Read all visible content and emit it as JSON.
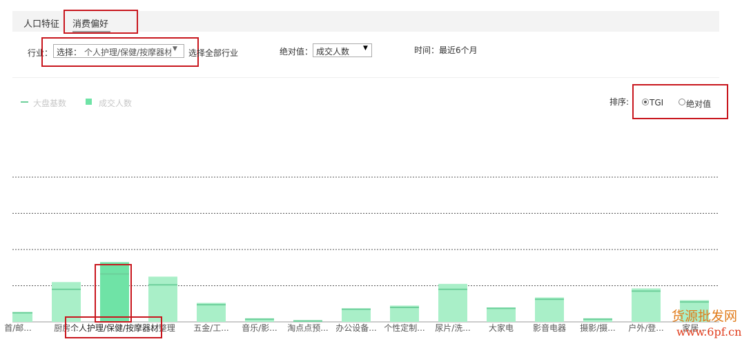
{
  "tabs": [
    {
      "label": "人口特征",
      "active": false
    },
    {
      "label": "消费偏好",
      "active": true
    }
  ],
  "filters": {
    "industry_label": "行业：",
    "industry_select_prefix": "选择：",
    "industry_select_value": "个人护理/保健/按摩器材",
    "select_all_link": "选择全部行业",
    "absolute_label": "绝对值：",
    "absolute_select_value": "成交人数",
    "time_text": "时间：最近6个月"
  },
  "legend": {
    "baseline_label": "大盘基数",
    "value_label": "成交人数"
  },
  "sort": {
    "label": "排序:",
    "options": [
      {
        "label": "TGI",
        "selected": true
      },
      {
        "label": "绝对值",
        "selected": false
      }
    ]
  },
  "watermark": {
    "line1": "货源批发网",
    "line2": "www.6pf.cn"
  },
  "colors": {
    "accent_red": "#c8161d",
    "bar_fill": "#a9efc8",
    "bar_highlight": "#6fe3a6",
    "baseline_line": "#6ccf9a",
    "watermark": "#e07b1a"
  },
  "chart_data": {
    "type": "bar",
    "categories": [
      "首/邮...",
      "厨房...",
      "个人护理/保健/按摩器材",
      "...整理",
      "五金/工...",
      "音乐/影...",
      "淘点点预...",
      "办公设备...",
      "个性定制...",
      "尿片/洗...",
      "大家电",
      "影音电器",
      "摄影/摄...",
      "户外/登...",
      "家居..."
    ],
    "series": [
      {
        "name": "成交人数",
        "values": [
          11,
          44,
          66,
          50,
          21,
          4,
          2,
          15,
          18,
          42,
          16,
          27,
          4,
          37,
          24
        ]
      },
      {
        "name": "大盘基数",
        "values": [
          10,
          36,
          53,
          41,
          19,
          3,
          1,
          14,
          16,
          36,
          15,
          25,
          3,
          34,
          22
        ]
      }
    ],
    "highlight_index": 2,
    "ylim": [
      0,
      200
    ],
    "grid": true,
    "legend_position": "top-left"
  }
}
